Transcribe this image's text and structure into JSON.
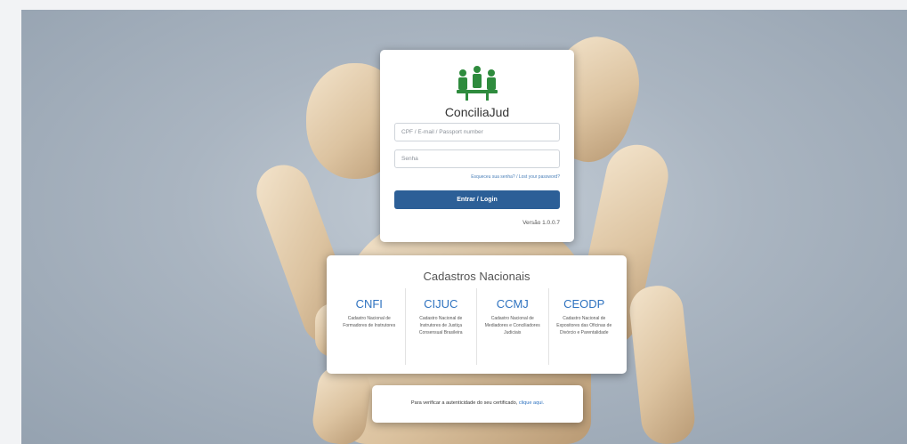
{
  "brand": {
    "name": "ConciliaJud",
    "colors": {
      "logo": "#2e8b3d",
      "primary_button": "#2c5f97",
      "link": "#2f73c0"
    }
  },
  "login": {
    "username_placeholder": "CPF / E-mail / Passport number",
    "password_placeholder": "Senha",
    "forgot_password": "Esqueceu sua senha? / Lost your password?",
    "submit_label": "Entrar / Login",
    "version": "Versão 1.0.0.7"
  },
  "cadastros": {
    "title": "Cadastros Nacionais",
    "items": [
      {
        "abbr": "CNFI",
        "description": "Cadastro Nacional de Formadores de Instrutores"
      },
      {
        "abbr": "CIJUC",
        "description": "Cadastro Nacional de Instrutores de Justiça Consensual Brasileira"
      },
      {
        "abbr": "CCMJ",
        "description": "Cadastro Nacional de Mediadores e Conciliadores Judiciais"
      },
      {
        "abbr": "CEODP",
        "description": "Cadastro Nacional de Expositores das Oficinas de Divórcio e Parentalidade"
      }
    ]
  },
  "verify": {
    "text": "Para verificar a autenticidade do seu certificado,",
    "link_label": "clique aqui."
  }
}
